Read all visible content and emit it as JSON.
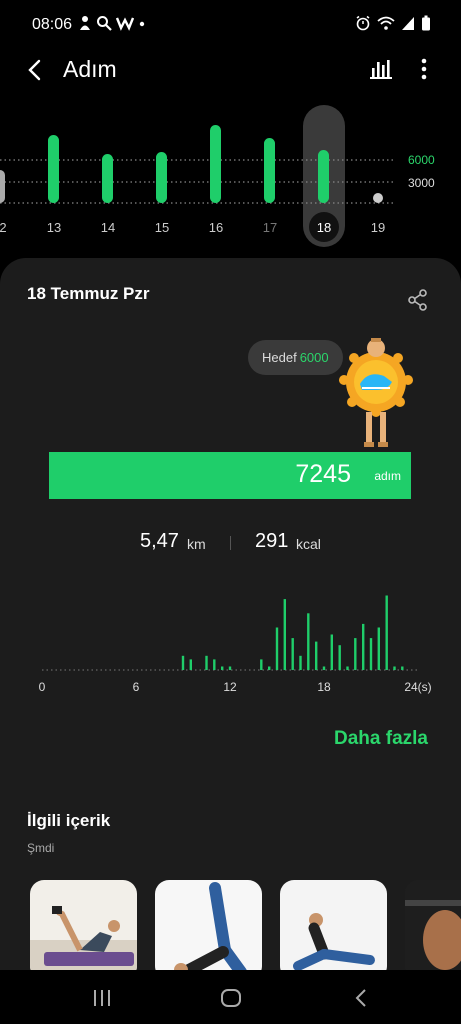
{
  "status_bar": {
    "time": "08:06",
    "left_icons": [
      "person-icon",
      "search-icon",
      "w-app-icon",
      "dot-icon"
    ],
    "right_icons": [
      "alarm-icon",
      "wifi-icon",
      "signal-icon",
      "battery-icon"
    ]
  },
  "app_bar": {
    "title": "Adım",
    "back_icon": "back-arrow-icon",
    "actions": [
      "bar-chart-icon",
      "more-vert-icon"
    ]
  },
  "weekly_chart": {
    "ref_lines": [
      "6000",
      "3000"
    ],
    "days": [
      "2",
      "13",
      "14",
      "15",
      "16",
      "17",
      "18",
      "19"
    ],
    "selected_day": "18",
    "colors": {
      "bar": "#1fce6a",
      "ref_label_6000": "#2bd66b",
      "selected_pill": "#3a3a3a"
    }
  },
  "card": {
    "date": "18 Temmuz Pzr",
    "share_icon": "share-icon",
    "goal_label": "Hedef",
    "goal_value": "6000",
    "steps_value": "7245",
    "steps_unit": "adım",
    "distance_value": "5,47",
    "distance_unit": "km",
    "calories_value": "291",
    "calories_unit": "kcal",
    "more_link": "Daha fazla",
    "related_title": "İlgili içerik",
    "related_subtitle": "Şmdi"
  },
  "hourly_chart": {
    "x_labels": [
      "0",
      "6",
      "12",
      "18",
      "24(s)"
    ]
  },
  "chart_data": {
    "type": "bar",
    "xlabel": "",
    "ylabel": "",
    "categories": [
      "0",
      "0.5",
      "1",
      "1.5",
      "2",
      "2.5",
      "3",
      "3.5",
      "4",
      "4.5",
      "5",
      "5.5",
      "6",
      "6.5",
      "7",
      "7.5",
      "8",
      "8.5",
      "9",
      "9.5",
      "10",
      "10.5",
      "11",
      "11.5",
      "12",
      "12.5",
      "13",
      "13.5",
      "14",
      "14.5",
      "15",
      "15.5",
      "16",
      "16.5",
      "17",
      "17.5",
      "18",
      "18.5",
      "19",
      "19.5",
      "20",
      "20.5",
      "21",
      "21.5",
      "22",
      "22.5",
      "23",
      "23.5"
    ],
    "values": [
      0,
      0,
      0,
      0,
      0,
      0,
      0,
      0,
      0,
      0,
      0,
      0,
      0,
      0,
      0,
      0,
      0,
      0,
      40,
      30,
      0,
      40,
      30,
      10,
      10,
      0,
      0,
      0,
      30,
      10,
      120,
      200,
      90,
      40,
      160,
      80,
      10,
      100,
      70,
      10,
      90,
      130,
      90,
      120,
      210,
      10,
      10,
      0
    ],
    "ylim": [
      0,
      220
    ]
  },
  "nav_bar": {
    "buttons": [
      "recents-icon",
      "home-icon",
      "back-nav-icon"
    ]
  }
}
